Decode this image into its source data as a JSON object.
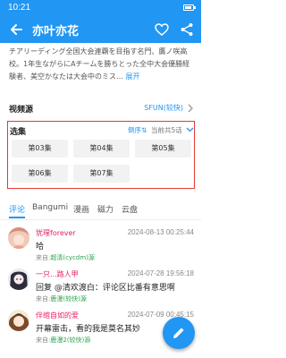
{
  "status": {
    "time": "10:21"
  },
  "header": {
    "title": "亦叶亦花"
  },
  "description": {
    "text": "チアリーディング全国大会連覇を目指す名門、鷹ノ咲高校。1年生ながらにAチームを勝ちとった全中大会優勝経験者、美空かなたは大会中のミス…",
    "more": "展开"
  },
  "video_source": {
    "label": "视频源",
    "value": "SFUN(较快)"
  },
  "episodes": {
    "label": "选集",
    "order": "倒序⇅",
    "count": "当前共5话",
    "items": [
      "第03集",
      "第04集",
      "第05集",
      "第06集",
      "第07集"
    ]
  },
  "tabs": [
    "评论",
    "Bangumi",
    "漫画",
    "磁力",
    "云盘"
  ],
  "comments": [
    {
      "user": "犹瑆forever",
      "time": "2024-08-13 00:25:44",
      "text": "哈",
      "source_label": "来自:",
      "source": "超清(cycdm)源"
    },
    {
      "user": "一只...路人甲",
      "time": "2024-07-28 19:56:18",
      "text": "回复 @清欢渡白：评论区比番有意思啊",
      "source_label": "来自:",
      "source": "鹿漫(较快)源"
    },
    {
      "user": "伴绾自如的爱",
      "time": "2024-07-09 00:45:15",
      "text": "开幕雷击，看的我是莫名其妙",
      "source_label": "来自:",
      "source": "鹿漫2(较快)源"
    }
  ],
  "colors": {
    "primary": "#2196f3",
    "highlight_border": "#e53935",
    "username": "#e91e63",
    "source": "#2ea44f"
  }
}
